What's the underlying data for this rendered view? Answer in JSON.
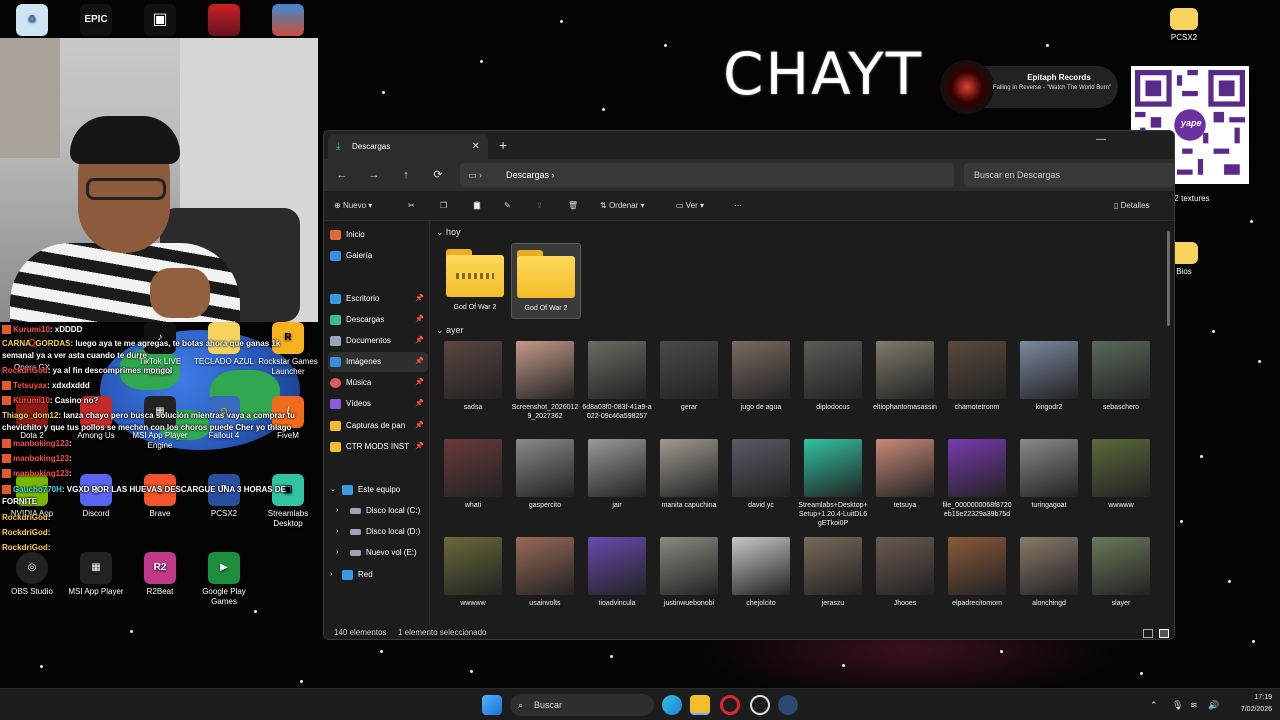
{
  "desktop": {
    "icons": [
      {
        "label": "",
        "icon": "recycle-bin-icon"
      },
      {
        "label": "",
        "icon": "epic-games-icon",
        "text": "EPIC"
      },
      {
        "label": "",
        "icon": "roblox-icon"
      },
      {
        "label": "",
        "icon": "game-icon-1"
      },
      {
        "label": "",
        "icon": "game-icon-2"
      },
      {
        "label": "PCSX2",
        "icon": "folder-icon"
      },
      {
        "label": "2 textures",
        "icon": "folder-icon"
      },
      {
        "label": "Bios",
        "icon": "folder-icon"
      },
      {
        "label": "Opera GX",
        "icon": "opera-gx-icon"
      },
      {
        "label": "TikTok LIVE Studio",
        "icon": "tiktok-icon"
      },
      {
        "label": "TECLADO AZUL",
        "icon": "folder-icon"
      },
      {
        "label": "Rockstar Games Launcher",
        "icon": "rockstar-icon"
      },
      {
        "label": "Dota 2",
        "icon": "dota-icon"
      },
      {
        "label": "Among Us",
        "icon": "among-us-icon"
      },
      {
        "label": "MSI App Player Engine",
        "icon": "msi-icon"
      },
      {
        "label": "Fallout 4",
        "icon": "fallout-icon"
      },
      {
        "label": "FiveM",
        "icon": "fivem-icon"
      },
      {
        "label": "NVIDIA App",
        "icon": "nvidia-icon"
      },
      {
        "label": "Discord",
        "icon": "discord-icon"
      },
      {
        "label": "Brave",
        "icon": "brave-icon"
      },
      {
        "label": "PCSX2",
        "icon": "pcsx2-icon"
      },
      {
        "label": "Streamlabs Desktop",
        "icon": "streamlabs-icon"
      },
      {
        "label": "OBS Studio",
        "icon": "obs-icon"
      },
      {
        "label": "MSI App Player",
        "icon": "msi-icon"
      },
      {
        "label": "R2Beat",
        "icon": "r2beat-icon"
      },
      {
        "label": "Google Play Games",
        "icon": "google-play-games-icon"
      }
    ]
  },
  "stream": {
    "logo_text": "CHAYT",
    "music": {
      "label": "Epitaph Records",
      "track": "Falling In Reverse - \"Watch The World Burn\""
    },
    "qr_label": "yape",
    "chat": [
      {
        "user": "Kurumi10",
        "msg": ": xDDDD"
      },
      {
        "user": "CARNA_GORDAS",
        "msg": ": luego aya te me agregas, te botas ahora que ganas 1k"
      },
      {
        "user": "",
        "msg": "semanal ya a ver asta cuando te durre"
      },
      {
        "user": "RockdriGod",
        "msg": ": ya al fin descomprimes mongol"
      },
      {
        "user": "Tetsuyax",
        "msg": ": xdxdxddd"
      },
      {
        "user": "Kurumi10",
        "msg": ": Casino no?"
      },
      {
        "user": "Thiago_dom12",
        "msg": ": lanza chayo pero busca solución mientras vaya a comprar tu"
      },
      {
        "user": "",
        "msg": "chevichito y que tus pollos se mechen con los choros puede Cher yo thiago"
      },
      {
        "user": "manboking123",
        "msg": ":"
      },
      {
        "user": "manboking123",
        "msg": ":"
      },
      {
        "user": "manboking123",
        "msg": ":"
      },
      {
        "user": "Gaucho770H",
        "msg": ": VGXD POR LAS HUEVAS DESCARGUE UNA 3 HORAS DE"
      },
      {
        "user": "",
        "msg": "FORNITE"
      },
      {
        "user": "RockdriGod",
        "msg": ":"
      },
      {
        "user": "RockdriGod",
        "msg": ":"
      },
      {
        "user": "RockdriGod",
        "msg": ":"
      }
    ]
  },
  "explorer": {
    "tab_title": "Descargas",
    "breadcrumb": "Descargas",
    "search_placeholder": "Buscar en Descargas",
    "toolbar": {
      "new": "Nuevo",
      "sort": "Ordenar",
      "view": "Ver",
      "more": "···",
      "details": "Detalles"
    },
    "sidebar": [
      {
        "label": "Inicio",
        "color": "#e06b3a"
      },
      {
        "label": "Galería",
        "color": "#3a8ee0"
      },
      {
        "label": "Escritorio",
        "color": "#3a9ae0",
        "pinned": true
      },
      {
        "label": "Descargas",
        "color": "#3cc08a",
        "pinned": true
      },
      {
        "label": "Documentos",
        "color": "#9aa6b8",
        "pinned": true
      },
      {
        "label": "Imágenes",
        "color": "#3a8ee0",
        "pinned": true
      },
      {
        "label": "Música",
        "color": "#e05a5a",
        "pinned": true
      },
      {
        "label": "Vídeos",
        "color": "#8a5ae0",
        "pinned": true
      },
      {
        "label": "Capturas de pan",
        "color": "#f2bd2b",
        "pinned": true
      },
      {
        "label": "CTR MODS INST",
        "color": "#f2bd2b",
        "pinned": true
      },
      {
        "label": "Este equipo",
        "color": "#3a9ae0"
      },
      {
        "label": "Disco local (C:)",
        "color": "#9aa6b8"
      },
      {
        "label": "Disco local (D:)",
        "color": "#9aa6b8"
      },
      {
        "label": "Nuevo vol (E:)",
        "color": "#9aa6b8"
      },
      {
        "label": "Red",
        "color": "#3a9ae0"
      }
    ],
    "groups": {
      "today": "hoy",
      "yesterday": "ayer"
    },
    "today_items": [
      {
        "name": "God Of War 2",
        "type": "zip"
      },
      {
        "name": "God Of War 2",
        "type": "folder"
      }
    ],
    "yesterday_items": [
      {
        "name": "sadsa",
        "color": "#5a4640"
      },
      {
        "name": "Screenshot_20260129_2027362",
        "color": "#c49a8a"
      },
      {
        "name": "6d8a03f0-083f-41a9-a022-09c46a598257",
        "color": "#6d6a60"
      },
      {
        "name": "gerar",
        "color": "#4a4a4a"
      },
      {
        "name": "jugo de agua",
        "color": "#7a6b60"
      },
      {
        "name": "diplodocus",
        "color": "#5d5a55"
      },
      {
        "name": "eltiophantomasassin",
        "color": "#807a6a"
      },
      {
        "name": "chamotetronm",
        "color": "#5a4a3c"
      },
      {
        "name": "kingodr2",
        "color": "#7a8aa0"
      },
      {
        "name": "sebaschero",
        "color": "#5a6a5a"
      },
      {
        "name": "whati",
        "color": "#6a3a3a"
      },
      {
        "name": "gaspercito",
        "color": "#8a8a8a"
      },
      {
        "name": "jair",
        "color": "#9a9a98"
      },
      {
        "name": "manita capuchina",
        "color": "#a09a90"
      },
      {
        "name": "david yc",
        "color": "#5a5a66"
      },
      {
        "name": "Streamlabs+Desktop+Setup+1.20.4-LuitDL6gETkoi0P",
        "color": "#31c3a2"
      },
      {
        "name": "tetsuya",
        "color": "#c88a7a"
      },
      {
        "name": "file_0000000068f8720eb15e22329a39b75d",
        "color": "#7a3ab0"
      },
      {
        "name": "turingagoat",
        "color": "#8a8a8a"
      },
      {
        "name": "wwwww",
        "color": "#5a6a3a"
      },
      {
        "name": "wwwww",
        "color": "#6a6a3a"
      },
      {
        "name": "usainvolts",
        "color": "#9a6a5a"
      },
      {
        "name": "tioadvincula",
        "color": "#6a4ab0"
      },
      {
        "name": "justinwuebonobi",
        "color": "#8a8a80"
      },
      {
        "name": "chejolcito",
        "color": "#c8c8c8"
      },
      {
        "name": "jeraszu",
        "color": "#7a6a5a"
      },
      {
        "name": "Jhooes",
        "color": "#6a5a50"
      },
      {
        "name": "elpadrecitomom",
        "color": "#8a5a3a"
      },
      {
        "name": "alonchingd",
        "color": "#8a7a6a"
      },
      {
        "name": "slayer",
        "color": "#6a7a5a"
      }
    ],
    "status": {
      "count": "140 elementos",
      "selected": "1 elemento seleccionado"
    }
  },
  "taskbar": {
    "search": "Buscar",
    "time": "17:19",
    "date": "7/02/2026"
  }
}
